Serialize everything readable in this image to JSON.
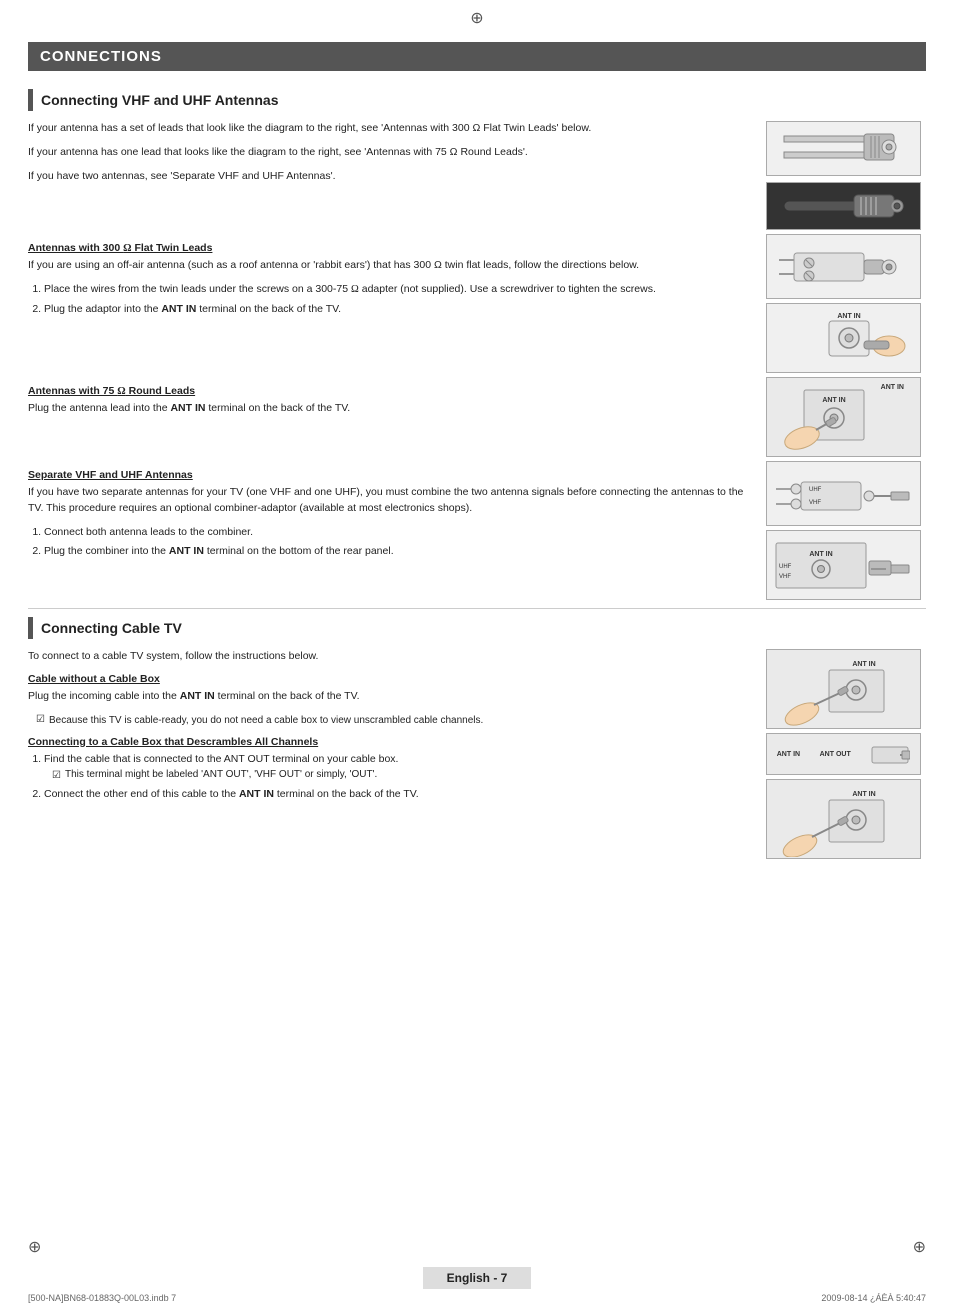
{
  "page": {
    "title": "CONNECTIONS",
    "footer_text": "English - 7",
    "footer_left": "[500-NA]BN68-01883Q-00L03.indb   7",
    "footer_right": "2009-08-14   ¿ÁÈÀ 5:40:47"
  },
  "sections": {
    "vhf_uhf": {
      "heading": "Connecting VHF and UHF Antennas",
      "para1": "If your antenna has a set of leads that look like the diagram to the right, see 'Antennas with 300 Ω Flat Twin Leads' below.",
      "para2": "If your antenna has one lead that looks like the diagram to the right, see 'Antennas with 75 Ω Round Leads'.",
      "para3": "If you have two antennas, see 'Separate VHF and UHF Antennas'.",
      "sub1": {
        "heading": "Antennas with 300 Ω Flat Twin Leads",
        "body": "If you are using an off-air antenna (such as a roof antenna or 'rabbit ears') that has 300 Ω twin flat leads, follow the directions below.",
        "steps": [
          "Place the wires from the twin leads under the screws on a 300-75 Ω adapter (not supplied). Use a screwdriver to tighten the screws.",
          "Plug the adaptor into the ANT IN terminal on the back of the TV."
        ]
      },
      "sub2": {
        "heading": "Antennas with 75 Ω Round Leads",
        "body": "Plug the antenna lead into the ANT IN terminal on the back of the TV."
      },
      "sub3": {
        "heading": "Separate VHF and UHF Antennas",
        "body": "If you have two separate antennas for your TV (one VHF and one UHF), you must combine the two antenna signals before connecting the antennas to the TV. This procedure requires an optional combiner-adaptor (available at most electronics shops).",
        "steps": [
          "Connect both antenna leads to the combiner.",
          "Plug the combiner into the ANT IN terminal on the bottom of the rear panel."
        ]
      }
    },
    "cable_tv": {
      "heading": "Connecting Cable TV",
      "intro": "To connect to a cable TV system, follow the instructions below.",
      "sub1": {
        "heading": "Cable without a Cable Box",
        "body": "Plug the incoming cable into the ANT IN terminal on the back of the TV.",
        "note": "Because this TV is cable-ready, you do not need a cable box to view unscrambled cable channels."
      },
      "sub2": {
        "heading": "Connecting to a Cable Box that Descrambles All Channels",
        "steps": [
          "Find the cable that is connected to the ANT OUT terminal on your cable box.",
          "Connect the other end of this cable to the ANT IN terminal on the back of the TV."
        ],
        "note1": "This terminal might be labeled 'ANT OUT', 'VHF OUT' or simply, 'OUT'."
      }
    }
  }
}
